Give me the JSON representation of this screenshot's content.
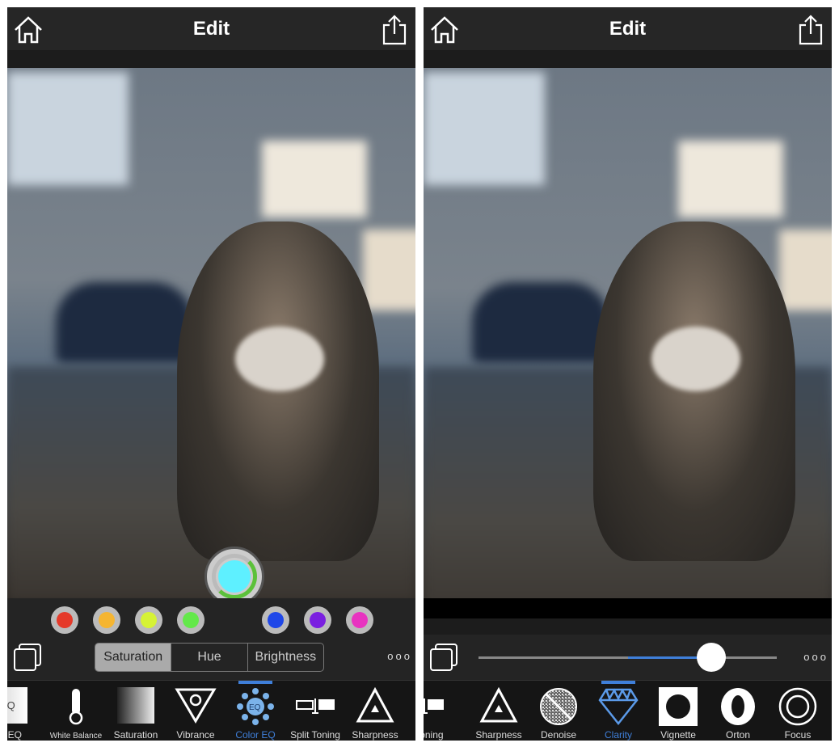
{
  "left": {
    "title": "Edit",
    "header_icons": [
      "home-icon",
      "share-icon"
    ],
    "color_eq": {
      "dial_color": "#5ef0ff",
      "dots": [
        {
          "name": "red",
          "color": "#e53a2a"
        },
        {
          "name": "orange",
          "color": "#f5b531"
        },
        {
          "name": "yellow",
          "color": "#d6f235"
        },
        {
          "name": "green",
          "color": "#63e84a"
        },
        {
          "name": "blue",
          "color": "#1f47e8"
        },
        {
          "name": "purple",
          "color": "#7a1fe0"
        },
        {
          "name": "magenta",
          "color": "#e834c0"
        }
      ]
    },
    "segments": [
      {
        "label": "Saturation",
        "selected": true
      },
      {
        "label": "Hue",
        "selected": false
      },
      {
        "label": "Brightness",
        "selected": false
      }
    ],
    "more_label": "ooo",
    "tools": [
      {
        "label": "ne EQ",
        "icon_text": "EQ"
      },
      {
        "label": "White Balance"
      },
      {
        "label": "Saturation"
      },
      {
        "label": "Vibrance"
      },
      {
        "label": "Color EQ",
        "active": true,
        "icon_text": "EQ"
      },
      {
        "label": "Split Toning"
      },
      {
        "label": "Sharpness"
      }
    ]
  },
  "right": {
    "title": "Edit",
    "header_icons": [
      "home-icon",
      "share-icon"
    ],
    "slider": {
      "value_fraction": 0.78,
      "center_fraction": 0.5,
      "fill_color": "#3f7fd9"
    },
    "more_label": "ooo",
    "tools": [
      {
        "label": "lit Toning"
      },
      {
        "label": "Sharpness"
      },
      {
        "label": "Denoise"
      },
      {
        "label": "Clarity",
        "active": true
      },
      {
        "label": "Vignette"
      },
      {
        "label": "Orton"
      },
      {
        "label": "Focus"
      }
    ]
  }
}
